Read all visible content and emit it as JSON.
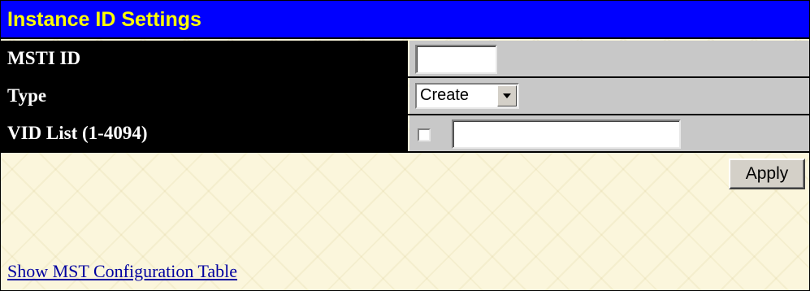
{
  "title": "Instance ID Settings",
  "colors": {
    "title_bg": "#0000ff",
    "title_text": "#ffff00",
    "label_bg": "#000000",
    "label_text": "#ffffff",
    "value_bg": "#c8c8c8",
    "page_bg": "#fbf6dc",
    "link": "#0000a0"
  },
  "form": {
    "msti_id": {
      "label": "MSTI ID",
      "value": "",
      "placeholder": ""
    },
    "type": {
      "label": "Type",
      "selected": "Create"
    },
    "vid_list": {
      "label": "VID List (1-4094)",
      "checked": false,
      "value": "",
      "placeholder": ""
    }
  },
  "apply_label": "Apply",
  "link_text": "Show MST Configuration Table"
}
